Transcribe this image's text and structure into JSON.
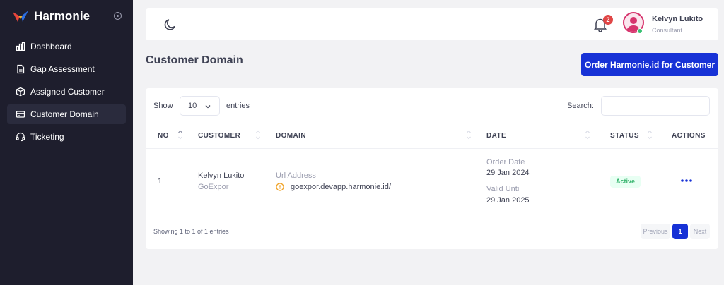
{
  "brand": {
    "name": "Harmonie"
  },
  "sidebar": {
    "items": [
      {
        "label": "Dashboard",
        "icon": "bar-chart-icon",
        "active": false
      },
      {
        "label": "Gap Assessment",
        "icon": "document-icon",
        "active": false
      },
      {
        "label": "Assigned Customer",
        "icon": "cube-icon",
        "active": false
      },
      {
        "label": "Customer Domain",
        "icon": "credit-card-icon",
        "active": true
      },
      {
        "label": "Ticketing",
        "icon": "headset-icon",
        "active": false
      }
    ]
  },
  "header": {
    "notifications_count": "2",
    "user": {
      "name": "Kelvyn Lukito",
      "role": "Consultant"
    }
  },
  "page": {
    "title": "Customer Domain",
    "order_button": "Order Harmonie.id for Customer"
  },
  "table": {
    "show_label": "Show",
    "entries_value": "10",
    "entries_label": "entries",
    "search_label": "Search:",
    "search_value": "",
    "columns": [
      "NO",
      "CUSTOMER",
      "DOMAIN",
      "DATE",
      "STATUS",
      "ACTIONS"
    ],
    "rows": [
      {
        "no": "1",
        "customer_name": "Kelvyn Lukito",
        "customer_company": "GoExpor",
        "domain_label": "Url Address",
        "domain_url": "goexpor.devapp.harmonie.id/",
        "order_date_label": "Order Date",
        "order_date": "29 Jan 2024",
        "valid_until_label": "Valid Until",
        "valid_until": "29 Jan 2025",
        "status": "Active"
      }
    ],
    "info": "Showing 1 to 1 of 1 entries",
    "pagination": {
      "previous": "Previous",
      "current": "1",
      "next": "Next"
    }
  },
  "colors": {
    "sidebar_bg": "#1e1e2d",
    "primary": "#1732d6",
    "success": "#38b56f",
    "danger": "#e04646",
    "brand_red": "#e8453c",
    "brand_blue": "#2c6de0"
  }
}
